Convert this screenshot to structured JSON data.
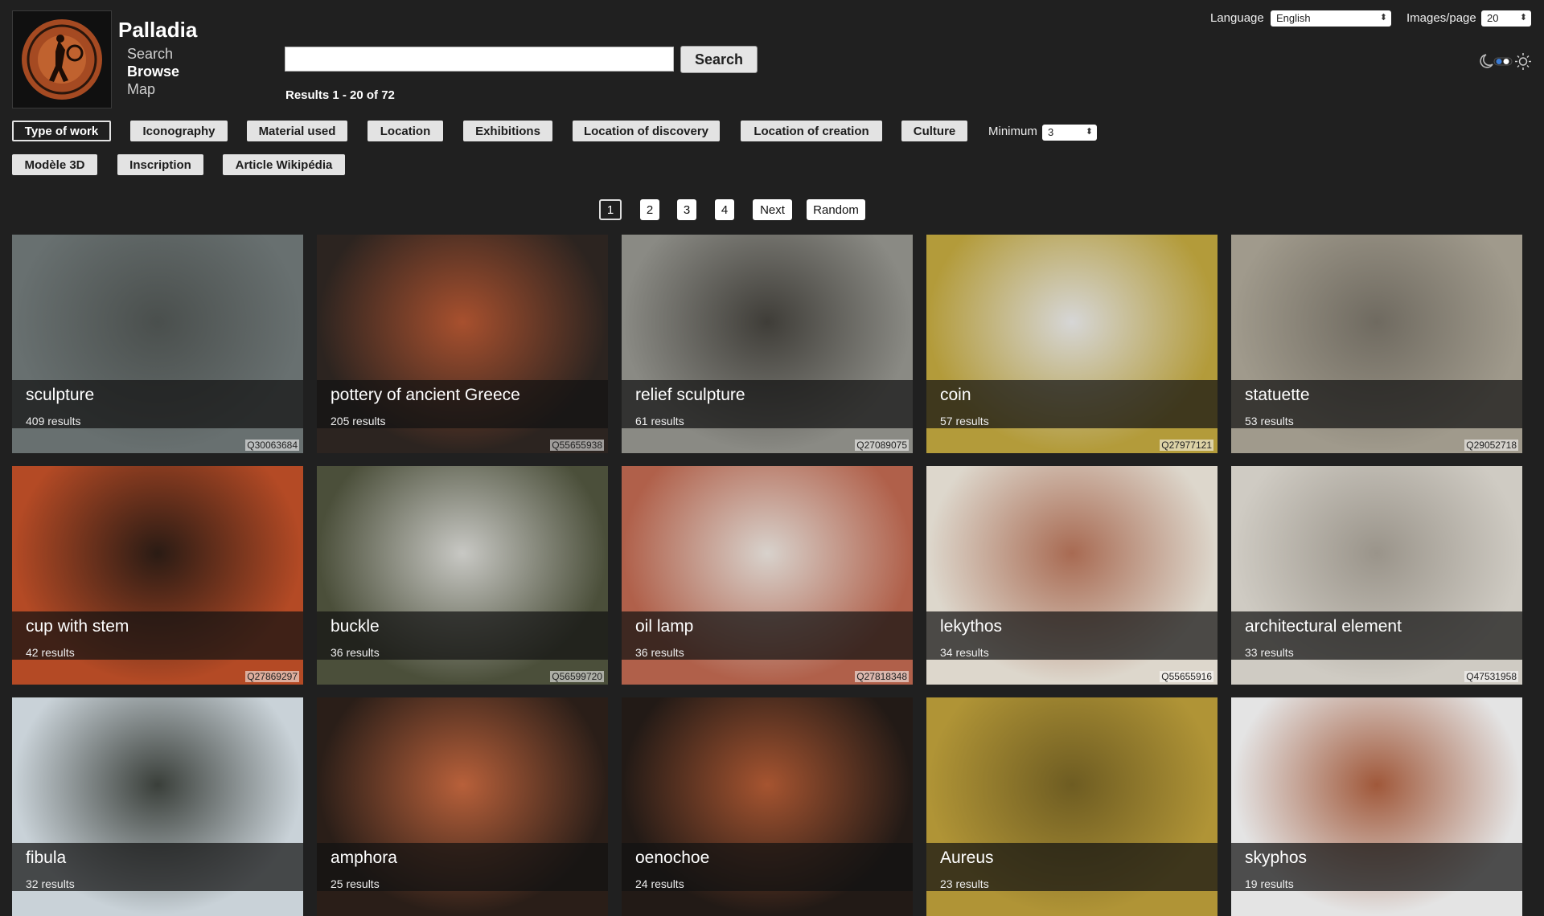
{
  "site": {
    "name": "Palladia"
  },
  "nav": [
    "Search",
    "Browse",
    "Map"
  ],
  "search": {
    "placeholder": "",
    "button": "Search",
    "results": "Results 1 - 20 of 72"
  },
  "settings": {
    "language_label": "Language",
    "language_value": "English",
    "images_per_page_label": "Images/page",
    "images_per_page_value": "20"
  },
  "theme_toggle_icons": [
    "moon-icon",
    "sun-icon"
  ],
  "facets": [
    "Type of work",
    "Iconography",
    "Material used",
    "Location",
    "Exhibitions",
    "Location of discovery",
    "Location of creation",
    "Culture",
    "Modèle 3D",
    "Inscription",
    "Article Wikipédia"
  ],
  "active_facet": "Type of work",
  "minimum": {
    "label": "Minimum",
    "value": "3"
  },
  "pagination": [
    "1",
    "2",
    "3",
    "4",
    "Next",
    "Random"
  ],
  "current_page": "1",
  "cards": [
    {
      "title": "sculpture",
      "count": "409 results",
      "qid": "Q30063684",
      "colors": [
        "#687070",
        "#4a4f4d"
      ]
    },
    {
      "title": "pottery of ancient Greece",
      "count": "205 results",
      "qid": "Q55655938",
      "colors": [
        "#2c2420",
        "#a8502e"
      ]
    },
    {
      "title": "relief sculpture",
      "count": "61 results",
      "qid": "Q27089075",
      "colors": [
        "#8a8a84",
        "#3f3d38"
      ]
    },
    {
      "title": "coin",
      "count": "57 results",
      "qid": "Q27977121",
      "colors": [
        "#b39b3a",
        "#d6d6d6"
      ]
    },
    {
      "title": "statuette",
      "count": "53 results",
      "qid": "Q29052718",
      "colors": [
        "#a09a8c",
        "#6f6a60"
      ]
    },
    {
      "title": "cup with stem",
      "count": "42 results",
      "qid": "Q27869297",
      "colors": [
        "#b44a25",
        "#2a1b14"
      ]
    },
    {
      "title": "buckle",
      "count": "36 results",
      "qid": "Q56599720",
      "colors": [
        "#4b4f3a",
        "#c8c8c4"
      ]
    },
    {
      "title": "oil lamp",
      "count": "36 results",
      "qid": "Q27818348",
      "colors": [
        "#b0604a",
        "#d8d2cc"
      ]
    },
    {
      "title": "lekythos",
      "count": "34 results",
      "qid": "Q55655916",
      "colors": [
        "#ddd7cc",
        "#a86a52"
      ]
    },
    {
      "title": "architectural element",
      "count": "33 results",
      "qid": "Q47531958",
      "colors": [
        "#cfcbc3",
        "#9a948a"
      ]
    },
    {
      "title": "fibula",
      "count": "32 results",
      "qid": "",
      "colors": [
        "#c9d2d8",
        "#3a3f3a"
      ]
    },
    {
      "title": "amphora",
      "count": "25 results",
      "qid": "",
      "colors": [
        "#2a1e18",
        "#b8603a"
      ]
    },
    {
      "title": "oenochoe",
      "count": "24 results",
      "qid": "",
      "colors": [
        "#221a16",
        "#a65430"
      ]
    },
    {
      "title": "Aureus",
      "count": "23 results",
      "qid": "",
      "colors": [
        "#b09436",
        "#6e5c22"
      ]
    },
    {
      "title": "skyphos",
      "count": "19 results",
      "qid": "",
      "colors": [
        "#e4e4e4",
        "#a0583a"
      ]
    }
  ]
}
